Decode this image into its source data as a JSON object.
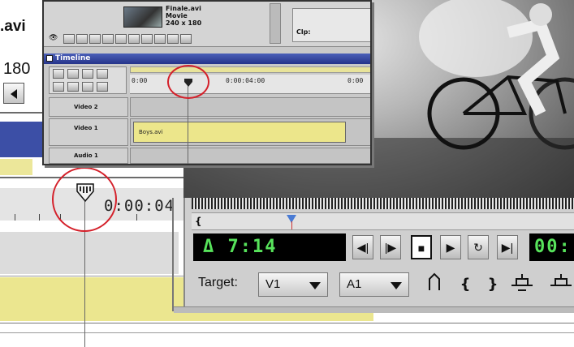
{
  "background_timeline": {
    "clip_title": ".avi",
    "frame_count": "180",
    "time_label": "0:00:04"
  },
  "inset_window": {
    "project": {
      "clip_name": "Finale.avi",
      "clip_type": "Movie",
      "clip_dims": "240 x 180",
      "second_panel_label": "Clp:"
    },
    "timeline": {
      "title": "Timeline",
      "ruler_labels": [
        "0:00",
        "0:00:04:00",
        "0:00"
      ],
      "tracks": [
        {
          "label": "Video 2"
        },
        {
          "label": "Video 1",
          "clip": "Boys.avi"
        },
        {
          "label": "Audio 1"
        }
      ]
    }
  },
  "monitor": {
    "timecode": "Δ 7:14",
    "timecode_right": "00:",
    "target_label": "Target:",
    "video_target": "V1",
    "audio_target": "A1",
    "buttons": {
      "frame_back": "◀|",
      "frame_forward": "|▶",
      "stop": "■",
      "play": "▶",
      "loop": "↻",
      "next_edit": "▶|"
    }
  },
  "colors": {
    "timecode_green": "#57e35b",
    "clip_yellow": "#ebe68f",
    "highlight_red": "#d4202a",
    "title_blue": "#2f40a0"
  }
}
